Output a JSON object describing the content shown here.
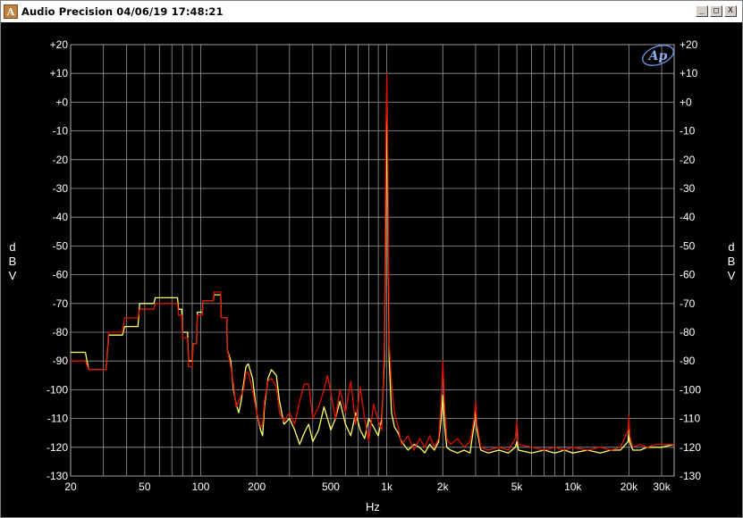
{
  "window": {
    "title": "Audio Precision  04/06/19 17:48:21",
    "icon": "audio-precision-app-icon",
    "controls": {
      "minimize": "_",
      "maximize": "□",
      "close": "X"
    }
  },
  "logo_text": "Ap",
  "chart_data": {
    "type": "line",
    "x_scale": "log",
    "xlim": [
      20,
      35000
    ],
    "ylim": [
      -130,
      20
    ],
    "xlabel": "Hz",
    "ylabel": [
      "d",
      "B",
      "V"
    ],
    "grid": true,
    "x_ticks": [
      {
        "v": 20,
        "label": "20"
      },
      {
        "v": 50,
        "label": "50"
      },
      {
        "v": 100,
        "label": "100"
      },
      {
        "v": 200,
        "label": "200"
      },
      {
        "v": 500,
        "label": "500"
      },
      {
        "v": 1000,
        "label": "1k"
      },
      {
        "v": 2000,
        "label": "2k"
      },
      {
        "v": 5000,
        "label": "5k"
      },
      {
        "v": 10000,
        "label": "10k"
      },
      {
        "v": 20000,
        "label": "20k"
      },
      {
        "v": 30000,
        "label": "30k"
      }
    ],
    "y_ticks": [
      {
        "v": 20,
        "label": "+20"
      },
      {
        "v": 10,
        "label": "+10"
      },
      {
        "v": 0,
        "label": "+0"
      },
      {
        "v": -10,
        "label": "-10"
      },
      {
        "v": -20,
        "label": "-20"
      },
      {
        "v": -30,
        "label": "-30"
      },
      {
        "v": -40,
        "label": "-40"
      },
      {
        "v": -50,
        "label": "-50"
      },
      {
        "v": -60,
        "label": "-60"
      },
      {
        "v": -70,
        "label": "-70"
      },
      {
        "v": -80,
        "label": "-80"
      },
      {
        "v": -90,
        "label": "-90"
      },
      {
        "v": -100,
        "label": "-100"
      },
      {
        "v": -110,
        "label": "-110"
      },
      {
        "v": -120,
        "label": "-120"
      },
      {
        "v": -130,
        "label": "-130"
      }
    ],
    "series": [
      {
        "color": "#ffff66",
        "points": [
          [
            20,
            -87
          ],
          [
            24,
            -87
          ],
          [
            25,
            -93
          ],
          [
            31,
            -93
          ],
          [
            32,
            -81
          ],
          [
            38,
            -81
          ],
          [
            39,
            -78
          ],
          [
            46,
            -78
          ],
          [
            47,
            -70
          ],
          [
            56,
            -70
          ],
          [
            57,
            -68
          ],
          [
            75,
            -68
          ],
          [
            76,
            -72
          ],
          [
            79,
            -72
          ],
          [
            80,
            -80
          ],
          [
            85,
            -80
          ],
          [
            86,
            -90
          ],
          [
            90,
            -90
          ],
          [
            91,
            -84
          ],
          [
            95,
            -84
          ],
          [
            96,
            -73
          ],
          [
            102,
            -73
          ],
          [
            103,
            -69
          ],
          [
            117,
            -69
          ],
          [
            118,
            -67
          ],
          [
            128,
            -67
          ],
          [
            129,
            -75
          ],
          [
            138,
            -75
          ],
          [
            139,
            -86
          ],
          [
            145,
            -90
          ],
          [
            150,
            -100
          ],
          [
            155,
            -105
          ],
          [
            160,
            -108
          ],
          [
            165,
            -104
          ],
          [
            170,
            -98
          ],
          [
            175,
            -92
          ],
          [
            180,
            -91
          ],
          [
            190,
            -96
          ],
          [
            200,
            -108
          ],
          [
            210,
            -114
          ],
          [
            215,
            -116
          ],
          [
            220,
            -106
          ],
          [
            230,
            -96
          ],
          [
            240,
            -93
          ],
          [
            255,
            -95
          ],
          [
            265,
            -104
          ],
          [
            280,
            -112
          ],
          [
            300,
            -110
          ],
          [
            320,
            -114
          ],
          [
            340,
            -119
          ],
          [
            360,
            -115
          ],
          [
            380,
            -112
          ],
          [
            400,
            -118
          ],
          [
            430,
            -114
          ],
          [
            460,
            -106
          ],
          [
            480,
            -110
          ],
          [
            500,
            -114
          ],
          [
            530,
            -110
          ],
          [
            560,
            -104
          ],
          [
            600,
            -112
          ],
          [
            640,
            -116
          ],
          [
            680,
            -108
          ],
          [
            720,
            -114
          ],
          [
            760,
            -117
          ],
          [
            800,
            -110
          ],
          [
            850,
            -113
          ],
          [
            900,
            -116
          ],
          [
            940,
            -110
          ],
          [
            970,
            -90
          ],
          [
            990,
            -30
          ],
          [
            1000,
            -5
          ],
          [
            1010,
            -30
          ],
          [
            1030,
            -90
          ],
          [
            1060,
            -108
          ],
          [
            1100,
            -113
          ],
          [
            1150,
            -115
          ],
          [
            1200,
            -118
          ],
          [
            1300,
            -121
          ],
          [
            1400,
            -119
          ],
          [
            1500,
            -120
          ],
          [
            1600,
            -122
          ],
          [
            1700,
            -119
          ],
          [
            1800,
            -121
          ],
          [
            1900,
            -118
          ],
          [
            1960,
            -110
          ],
          [
            2000,
            -102
          ],
          [
            2040,
            -112
          ],
          [
            2100,
            -120
          ],
          [
            2200,
            -121
          ],
          [
            2400,
            -122
          ],
          [
            2600,
            -121
          ],
          [
            2800,
            -122
          ],
          [
            2950,
            -112
          ],
          [
            3000,
            -106
          ],
          [
            3050,
            -114
          ],
          [
            3200,
            -121
          ],
          [
            3500,
            -122
          ],
          [
            4000,
            -121
          ],
          [
            4500,
            -122
          ],
          [
            4900,
            -120
          ],
          [
            5000,
            -118
          ],
          [
            5100,
            -121
          ],
          [
            6000,
            -122
          ],
          [
            7000,
            -121
          ],
          [
            8000,
            -122
          ],
          [
            9000,
            -121
          ],
          [
            10000,
            -122
          ],
          [
            12000,
            -121
          ],
          [
            14000,
            -122
          ],
          [
            16000,
            -121
          ],
          [
            18000,
            -121
          ],
          [
            19800,
            -118
          ],
          [
            20000,
            -114
          ],
          [
            20200,
            -118
          ],
          [
            21000,
            -121
          ],
          [
            23000,
            -121
          ],
          [
            25000,
            -120
          ],
          [
            28000,
            -120
          ],
          [
            30000,
            -120
          ],
          [
            35000,
            -119
          ]
        ]
      },
      {
        "color": "#dd1100",
        "points": [
          [
            20,
            -90
          ],
          [
            24,
            -90
          ],
          [
            25,
            -93
          ],
          [
            31,
            -93
          ],
          [
            32,
            -80
          ],
          [
            38,
            -80
          ],
          [
            39,
            -75
          ],
          [
            46,
            -75
          ],
          [
            47,
            -72
          ],
          [
            56,
            -72
          ],
          [
            57,
            -70
          ],
          [
            75,
            -70
          ],
          [
            76,
            -74
          ],
          [
            79,
            -74
          ],
          [
            80,
            -82
          ],
          [
            85,
            -82
          ],
          [
            86,
            -92
          ],
          [
            90,
            -92
          ],
          [
            91,
            -84
          ],
          [
            95,
            -84
          ],
          [
            96,
            -74
          ],
          [
            102,
            -74
          ],
          [
            103,
            -69
          ],
          [
            117,
            -69
          ],
          [
            118,
            -66
          ],
          [
            128,
            -66
          ],
          [
            129,
            -75
          ],
          [
            138,
            -75
          ],
          [
            139,
            -86
          ],
          [
            145,
            -92
          ],
          [
            150,
            -98
          ],
          [
            155,
            -106
          ],
          [
            160,
            -104
          ],
          [
            170,
            -100
          ],
          [
            175,
            -94
          ],
          [
            180,
            -94
          ],
          [
            190,
            -100
          ],
          [
            200,
            -108
          ],
          [
            210,
            -113
          ],
          [
            215,
            -112
          ],
          [
            220,
            -104
          ],
          [
            230,
            -97
          ],
          [
            240,
            -96
          ],
          [
            255,
            -99
          ],
          [
            265,
            -108
          ],
          [
            280,
            -111
          ],
          [
            300,
            -108
          ],
          [
            320,
            -112
          ],
          [
            340,
            -104
          ],
          [
            360,
            -98
          ],
          [
            380,
            -98
          ],
          [
            400,
            -110
          ],
          [
            430,
            -106
          ],
          [
            460,
            -100
          ],
          [
            480,
            -95
          ],
          [
            500,
            -101
          ],
          [
            530,
            -110
          ],
          [
            560,
            -100
          ],
          [
            600,
            -108
          ],
          [
            640,
            -97
          ],
          [
            680,
            -112
          ],
          [
            720,
            -99
          ],
          [
            760,
            -110
          ],
          [
            800,
            -118
          ],
          [
            850,
            -105
          ],
          [
            900,
            -111
          ],
          [
            940,
            -114
          ],
          [
            970,
            -84
          ],
          [
            990,
            -10
          ],
          [
            1000,
            10
          ],
          [
            1010,
            -10
          ],
          [
            1030,
            -84
          ],
          [
            1060,
            -98
          ],
          [
            1100,
            -108
          ],
          [
            1150,
            -113
          ],
          [
            1200,
            -119
          ],
          [
            1300,
            -116
          ],
          [
            1400,
            -121
          ],
          [
            1500,
            -117
          ],
          [
            1600,
            -120
          ],
          [
            1700,
            -116
          ],
          [
            1800,
            -120
          ],
          [
            1900,
            -117
          ],
          [
            1960,
            -104
          ],
          [
            2000,
            -90
          ],
          [
            2040,
            -105
          ],
          [
            2100,
            -117
          ],
          [
            2200,
            -119
          ],
          [
            2400,
            -117
          ],
          [
            2600,
            -120
          ],
          [
            2800,
            -118
          ],
          [
            2950,
            -110
          ],
          [
            3000,
            -104
          ],
          [
            3050,
            -112
          ],
          [
            3200,
            -120
          ],
          [
            3500,
            -121
          ],
          [
            4000,
            -120
          ],
          [
            4500,
            -121
          ],
          [
            4900,
            -117
          ],
          [
            5000,
            -111
          ],
          [
            5100,
            -119
          ],
          [
            6000,
            -120
          ],
          [
            7000,
            -121
          ],
          [
            8000,
            -120
          ],
          [
            9000,
            -121
          ],
          [
            10000,
            -120
          ],
          [
            12000,
            -121
          ],
          [
            14000,
            -120
          ],
          [
            16000,
            -121
          ],
          [
            18000,
            -120
          ],
          [
            19800,
            -114
          ],
          [
            20000,
            -109
          ],
          [
            20200,
            -116
          ],
          [
            21000,
            -120
          ],
          [
            23000,
            -119
          ],
          [
            25000,
            -120
          ],
          [
            28000,
            -119
          ],
          [
            30000,
            -119
          ],
          [
            35000,
            -119
          ]
        ]
      }
    ]
  }
}
